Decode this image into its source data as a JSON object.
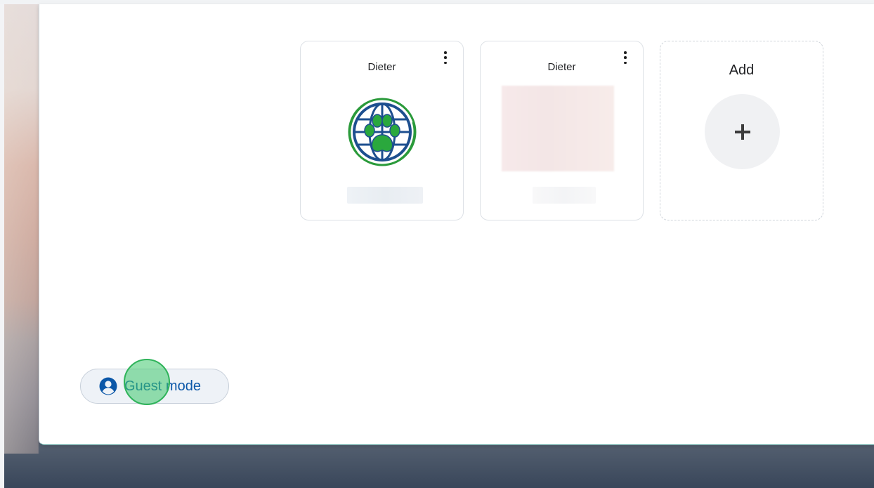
{
  "profiles": [
    {
      "name": "Dieter",
      "avatar": "paw-globe-logo"
    },
    {
      "name": "Dieter",
      "avatar": "blurred-photo"
    }
  ],
  "add_profile": {
    "label": "Add",
    "icon": "plus-icon"
  },
  "guest_mode": {
    "label": "Guest mode",
    "icon": "account-circle-icon"
  },
  "colors": {
    "accent": "#0b57a8",
    "logo_green": "#2a9a3a",
    "logo_blue": "#1d4f8f",
    "click_marker": "#40c86e"
  }
}
